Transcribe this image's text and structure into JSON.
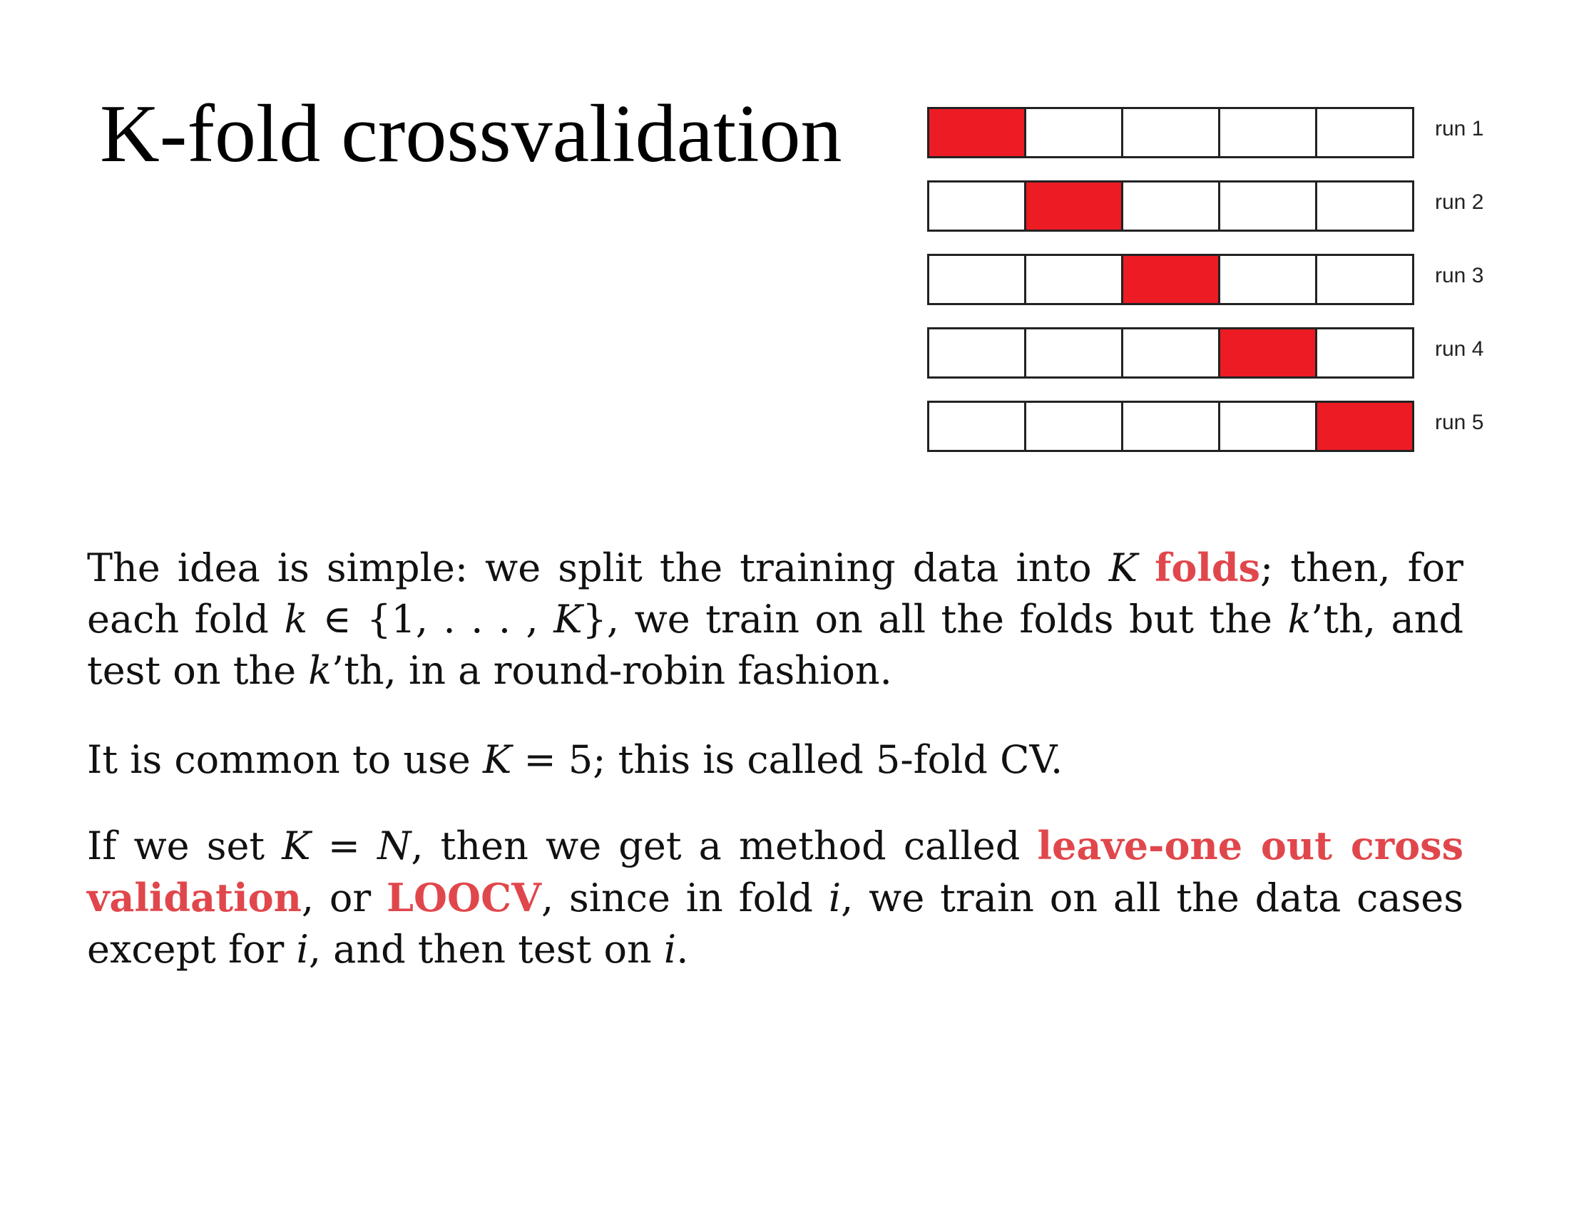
{
  "title": "K-fold crossvalidation",
  "diagram": {
    "fold_count": 5,
    "highlight_color": "#ed1c24",
    "runs": [
      {
        "label": "run 1",
        "test_fold": 1
      },
      {
        "label": "run 2",
        "test_fold": 2
      },
      {
        "label": "run 3",
        "test_fold": 3
      },
      {
        "label": "run 4",
        "test_fold": 4
      },
      {
        "label": "run 5",
        "test_fold": 5
      }
    ]
  },
  "paragraph1": {
    "a": "The idea is simple: we split the training data into ",
    "K": "K",
    "sp": " ",
    "folds": "folds",
    "b": "; then, for each fold ",
    "k1": "k",
    "c": " ∈ {1, . . . , ",
    "K2": "K",
    "d": "}, we train on all the folds but the ",
    "k2": "k",
    "e": "’th, and test on the ",
    "k3": "k",
    "f": "’th, in a round-robin fashion."
  },
  "paragraph2": {
    "a": "It is common to use ",
    "K": "K",
    "b": " = 5; this is called 5-fold CV."
  },
  "paragraph3": {
    "a": "If we set ",
    "K": "K",
    "b": " = ",
    "N": "N",
    "c": ", then we get a method called ",
    "loocv_long": "leave-one out cross validation",
    "d": ", or ",
    "loocv": "LOOCV",
    "e": ", since in fold ",
    "i1": "i",
    "f": ", we train on all the data cases except for ",
    "i2": "i",
    "g": ", and then test on ",
    "i3": "i",
    "h": "."
  }
}
